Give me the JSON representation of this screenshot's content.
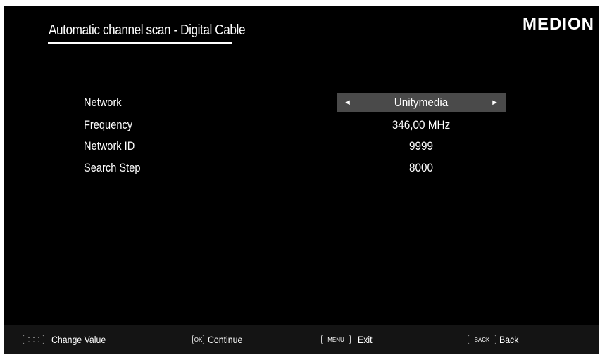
{
  "header": {
    "title": "Automatic channel scan - Digital Cable",
    "brand": "MEDION"
  },
  "settings": [
    {
      "label": "Network",
      "value": "Unitymedia"
    },
    {
      "label": "Frequency",
      "value": "346,00 MHz"
    },
    {
      "label": "Network ID",
      "value": "9999"
    },
    {
      "label": "Search Step",
      "value": "8000"
    }
  ],
  "selector_arrows": {
    "left": "◄",
    "right": "►"
  },
  "footer": {
    "hints": [
      {
        "key": "⋮⋮⋮",
        "label": "Change Value"
      },
      {
        "key": "OK",
        "label": "Continue"
      },
      {
        "key": "MENU",
        "label": "Exit"
      },
      {
        "key": "BACK",
        "label": "Back"
      }
    ]
  },
  "colors": {
    "background": "#000000",
    "text": "#ffffff",
    "selected_row": "#4a4a4a",
    "footer": "#141414"
  }
}
